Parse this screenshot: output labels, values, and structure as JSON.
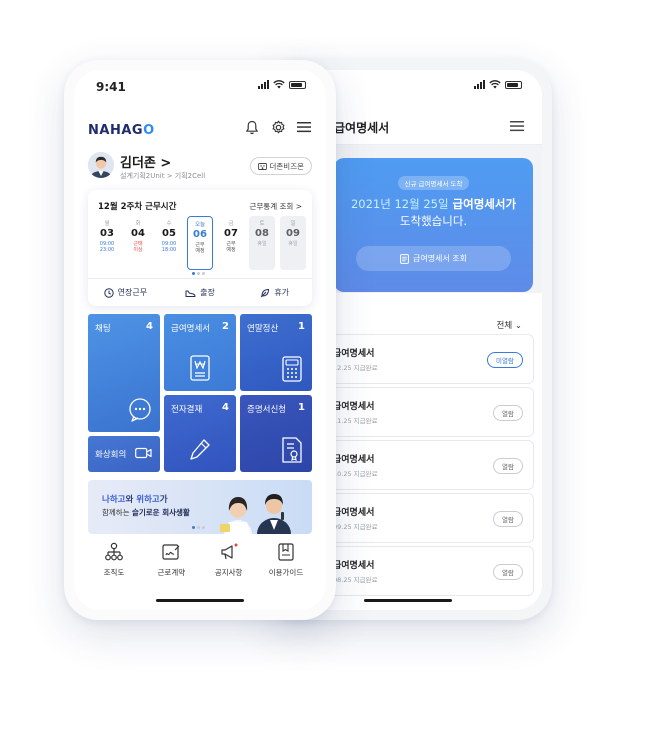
{
  "front": {
    "status": {
      "time": "9:41"
    },
    "logo": {
      "na": "NAHAG",
      "o": "O"
    },
    "profile": {
      "name": "김더존 >",
      "org": "설계기획2Unit > 기획2Cell",
      "button": "더존비즈온"
    },
    "work": {
      "title": "12월 2주차 근무시간",
      "link": "근무통계 조회 >",
      "days": [
        {
          "name": "월",
          "num": "03",
          "sub": "09:00\n23:00"
        },
        {
          "name": "화",
          "num": "04",
          "sub": "근태\n이상"
        },
        {
          "name": "수",
          "num": "05",
          "sub": "09:00\n18:00"
        },
        {
          "name": "오늘",
          "num": "06",
          "sub": "근무\n예정"
        },
        {
          "name": "금",
          "num": "07",
          "sub": "근무\n예정"
        },
        {
          "name": "토",
          "num": "08",
          "sub": "휴일"
        },
        {
          "name": "일",
          "num": "09",
          "sub": "휴일"
        }
      ],
      "actions": [
        "연장근무",
        "출장",
        "휴가"
      ]
    },
    "tiles": {
      "chat": {
        "label": "채팅",
        "count": "4"
      },
      "payslip": {
        "label": "급여명세서",
        "count": "2"
      },
      "yearend": {
        "label": "연말정산",
        "count": "1"
      },
      "approval": {
        "label": "전자결재",
        "count": "4"
      },
      "certificate": {
        "label": "증명서신청",
        "count": "1"
      },
      "meeting": {
        "label": "화상회의"
      }
    },
    "banner": {
      "line1_a": "나하고",
      "line1_b": "와 ",
      "line1_c": "위하고",
      "line1_d": "가",
      "line2_a": "함께하는 ",
      "line2_b": "슬기로운 회사생활"
    },
    "nav": [
      "조직도",
      "근로계약",
      "공지사항",
      "이용가이드"
    ]
  },
  "back": {
    "title": "급여명세서",
    "hero": {
      "badge": "신규 급여명세서 도착",
      "line1_date": "2021년 12월 25일",
      "line1_rest": " 급여명세서가",
      "line2": "도착했습니다.",
      "button": "급여명세서 조회"
    },
    "filter": "전체",
    "rows": [
      {
        "title": "급여명세서",
        "date": "12.25 지급완료",
        "button": "미열람"
      },
      {
        "title": "급여명세서",
        "date": "11.25 지급완료",
        "button": "열람"
      },
      {
        "title": "급여명세서",
        "date": "10.25 지급완료",
        "button": "열람"
      },
      {
        "title": "급여명세서",
        "date": "09.25 지급완료",
        "button": "열람"
      },
      {
        "title": "급여명세서",
        "date": "08.25 지급완료",
        "button": "열람"
      }
    ]
  },
  "colors": {
    "accent": "#3a7bd5",
    "tile_dark": "#3753b8",
    "tile_light": "#4a8fe3",
    "alert": "#e2463f"
  }
}
